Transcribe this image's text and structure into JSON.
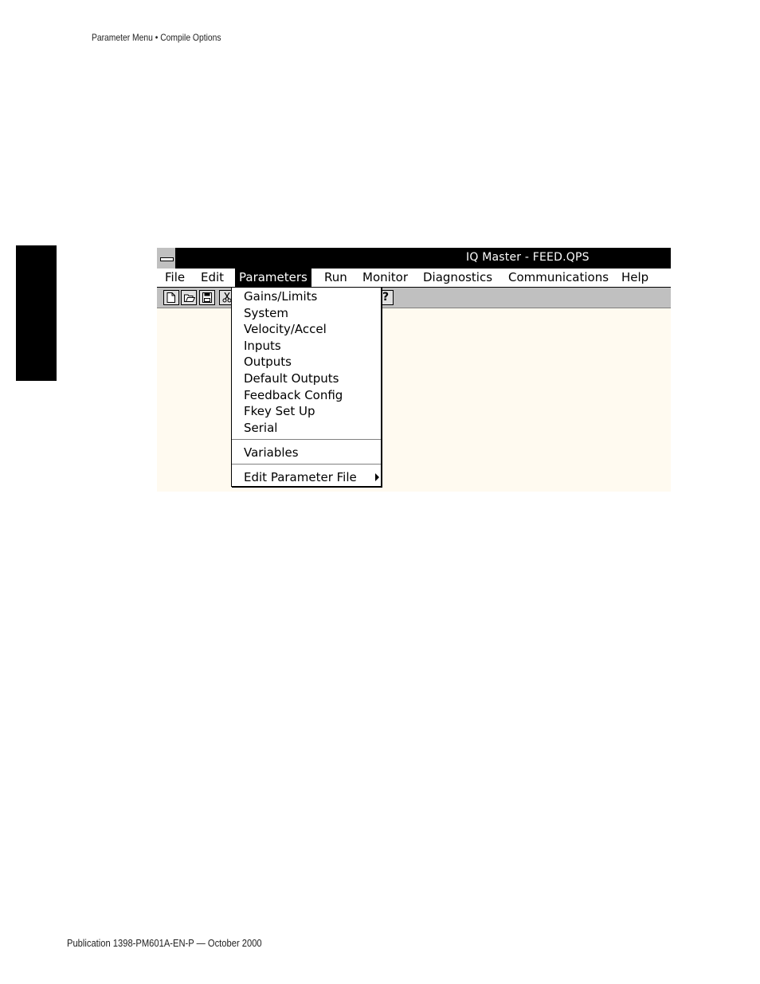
{
  "page": {
    "header": "Parameter Menu • Compile Options",
    "footer": "Publication 1398-PM601A-EN-P — October 2000"
  },
  "window": {
    "title": "IQ Master - FEED.QPS",
    "menubar": [
      {
        "label": "File"
      },
      {
        "label": "Edit"
      },
      {
        "label": "Parameters"
      },
      {
        "label": "Run"
      },
      {
        "label": "Monitor"
      },
      {
        "label": "Diagnostics"
      },
      {
        "label": "Communications"
      },
      {
        "label": "Help"
      }
    ],
    "toolbar": {
      "icons": [
        "new-file-icon",
        "open-folder-icon",
        "save-icon",
        "cut-icon",
        "help-icon"
      ],
      "help_glyph": "?"
    },
    "parameters_menu": {
      "items": [
        {
          "label": "Gains/Limits"
        },
        {
          "label": "System"
        },
        {
          "label": "Velocity/Accel"
        },
        {
          "label": "Inputs"
        },
        {
          "label": "Outputs"
        },
        {
          "label": "Default Outputs"
        },
        {
          "label": "Feedback Config"
        },
        {
          "label": "Fkey Set Up"
        },
        {
          "label": "Serial"
        },
        {
          "label": "Variables"
        },
        {
          "label": "Edit Parameter File"
        }
      ]
    }
  }
}
